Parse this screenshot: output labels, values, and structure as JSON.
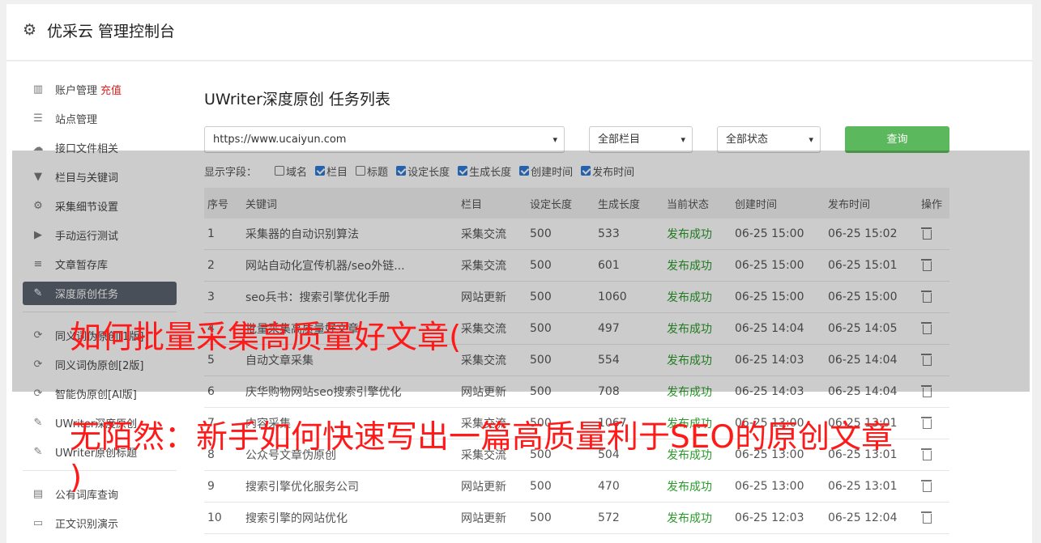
{
  "header": {
    "title": "优采云 管理控制台",
    "icon": "gear-icon"
  },
  "sidebar": {
    "items": [
      {
        "label": "账户管理",
        "extra": "充值",
        "icon": "bar-chart-icon"
      },
      {
        "label": "站点管理",
        "icon": "server-icon"
      },
      {
        "label": "接口文件相关",
        "icon": "cloud-upload-icon"
      },
      {
        "label": "栏目与关键词",
        "icon": "filter-icon"
      },
      {
        "label": "采集细节设置",
        "icon": "gears-icon"
      },
      {
        "label": "手动运行测试",
        "icon": "play-icon"
      },
      {
        "label": "文章暂存库",
        "icon": "database-icon"
      },
      {
        "label": "深度原创任务",
        "icon": "edit-icon",
        "active": true
      },
      {
        "label": "同义词伪原创[1版]",
        "icon": "refresh-icon"
      },
      {
        "label": "同义词伪原创[2版]",
        "icon": "refresh-icon"
      },
      {
        "label": "智能伪原创[AI版]",
        "icon": "refresh-icon"
      },
      {
        "label": "UWriter深度原创",
        "icon": "edit-icon"
      },
      {
        "label": "UWriter原创标题",
        "icon": "edit-icon"
      },
      {
        "label": "公有词库查询",
        "icon": "book-icon"
      },
      {
        "label": "正文识别演示",
        "icon": "monitor-icon"
      }
    ]
  },
  "main": {
    "title": "UWriter深度原创 任务列表",
    "site_select": "https://www.ucaiyun.com",
    "category_select": "全部栏目",
    "status_select": "全部状态",
    "query_label": "查询",
    "fields_label": "显示字段：",
    "fields": [
      {
        "label": "域名",
        "checked": false
      },
      {
        "label": "栏目",
        "checked": true
      },
      {
        "label": "标题",
        "checked": false
      },
      {
        "label": "设定长度",
        "checked": true
      },
      {
        "label": "生成长度",
        "checked": true
      },
      {
        "label": "创建时间",
        "checked": true
      },
      {
        "label": "发布时间",
        "checked": true
      }
    ],
    "columns": [
      "序号",
      "关键词",
      "栏目",
      "设定长度",
      "生成长度",
      "当前状态",
      "创建时间",
      "发布时间",
      "操作"
    ],
    "rows": [
      [
        "1",
        "采集器的自动识别算法",
        "采集交流",
        "500",
        "533",
        "发布成功",
        "06-25 15:00",
        "06-25 15:02"
      ],
      [
        "2",
        "网站自动化宣传机器/seo外链...",
        "采集交流",
        "500",
        "601",
        "发布成功",
        "06-25 15:00",
        "06-25 15:01"
      ],
      [
        "3",
        "seo兵书：搜索引擎优化手册",
        "网站更新",
        "500",
        "1060",
        "发布成功",
        "06-25 15:00",
        "06-25 15:00"
      ],
      [
        "4",
        "批量采集高质量好文章",
        "采集交流",
        "500",
        "497",
        "发布成功",
        "06-25 14:04",
        "06-25 14:05"
      ],
      [
        "5",
        "自动文章采集",
        "采集交流",
        "500",
        "554",
        "发布成功",
        "06-25 14:03",
        "06-25 14:04"
      ],
      [
        "6",
        "庆华购物网站seo搜索引擎优化",
        "网站更新",
        "500",
        "708",
        "发布成功",
        "06-25 14:03",
        "06-25 14:04"
      ],
      [
        "7",
        "内容采集",
        "采集交流",
        "500",
        "1067",
        "发布成功",
        "06-25 13:00",
        "06-25 13:01"
      ],
      [
        "8",
        "公众号文章伪原创",
        "采集交流",
        "500",
        "504",
        "发布成功",
        "06-25 13:00",
        "06-25 13:01"
      ],
      [
        "9",
        "搜索引擎优化服务公司",
        "网站更新",
        "500",
        "470",
        "发布成功",
        "06-25 13:00",
        "06-25 13:01"
      ],
      [
        "10",
        "搜索引擎的网站优化",
        "网站更新",
        "500",
        "572",
        "发布成功",
        "06-25 12:03",
        "06-25 12:04"
      ]
    ]
  },
  "overlay": {
    "line1": "如何批量采集高质量好文章(",
    "line2": "无陌然：新手如何快速写出一篇高质量利于SEO的原创文章",
    "line3": ")"
  }
}
